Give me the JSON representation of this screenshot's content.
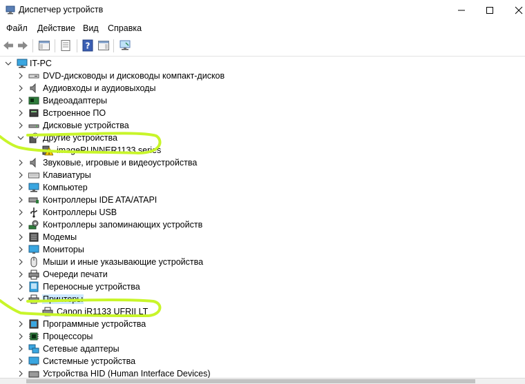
{
  "window": {
    "title": "Диспетчер устройств",
    "icon": "device-manager-icon",
    "controls": [
      "minimize",
      "maximize",
      "close"
    ]
  },
  "menu": [
    "Файл",
    "Действие",
    "Вид",
    "Справка"
  ],
  "toolbar": [
    "back-arrow-icon",
    "forward-arrow-icon",
    "show-hide-tree-icon",
    "properties-icon",
    "help-icon",
    "action-pane-icon",
    "scan-hardware-icon"
  ],
  "tree": {
    "root": "IT-PC",
    "items": [
      {
        "label": "DVD-дисководы и дисководы компакт-дисков",
        "icon": "dvd-drive-icon"
      },
      {
        "label": "Аудиовходы и аудиовыходы",
        "icon": "speaker-icon"
      },
      {
        "label": "Видеоадаптеры",
        "icon": "display-adapter-icon"
      },
      {
        "label": "Встроенное ПО",
        "icon": "firmware-icon"
      },
      {
        "label": "Дисковые устройства",
        "icon": "disk-drive-icon"
      },
      {
        "label": "Другие устройства",
        "icon": "unknown-device-icon",
        "expanded": true,
        "children": [
          {
            "label": "imageRUNNER1133 series",
            "icon": "warning-device-icon"
          }
        ]
      },
      {
        "label": "Звуковые, игровые и видеоустройства",
        "icon": "speaker-icon"
      },
      {
        "label": "Клавиатуры",
        "icon": "keyboard-icon"
      },
      {
        "label": "Компьютер",
        "icon": "computer-icon"
      },
      {
        "label": "Контроллеры IDE ATA/ATAPI",
        "icon": "ide-controller-icon"
      },
      {
        "label": "Контроллеры USB",
        "icon": "usb-icon"
      },
      {
        "label": "Контроллеры запоминающих устройств",
        "icon": "storage-controller-icon"
      },
      {
        "label": "Модемы",
        "icon": "modem-icon"
      },
      {
        "label": "Мониторы",
        "icon": "monitor-icon"
      },
      {
        "label": "Мыши и иные указывающие устройства",
        "icon": "mouse-icon"
      },
      {
        "label": "Очереди печати",
        "icon": "print-queue-icon"
      },
      {
        "label": "Переносные устройства",
        "icon": "portable-device-icon"
      },
      {
        "label": "Принтеры",
        "icon": "printer-icon",
        "expanded": true,
        "selected": true,
        "children": [
          {
            "label": "Canon iR1133 UFRII LT",
            "icon": "printer-icon"
          }
        ]
      },
      {
        "label": "Программные устройства",
        "icon": "software-device-icon"
      },
      {
        "label": "Процессоры",
        "icon": "cpu-icon"
      },
      {
        "label": "Сетевые адаптеры",
        "icon": "network-adapter-icon"
      },
      {
        "label": "Системные устройства",
        "icon": "system-device-icon"
      },
      {
        "label": "Устройства HID (Human Interface Devices)",
        "icon": "hid-icon"
      }
    ]
  },
  "colors": {
    "selection": "#cce8ff",
    "highlight": "#c8f52a",
    "warning": "#f5c400"
  }
}
